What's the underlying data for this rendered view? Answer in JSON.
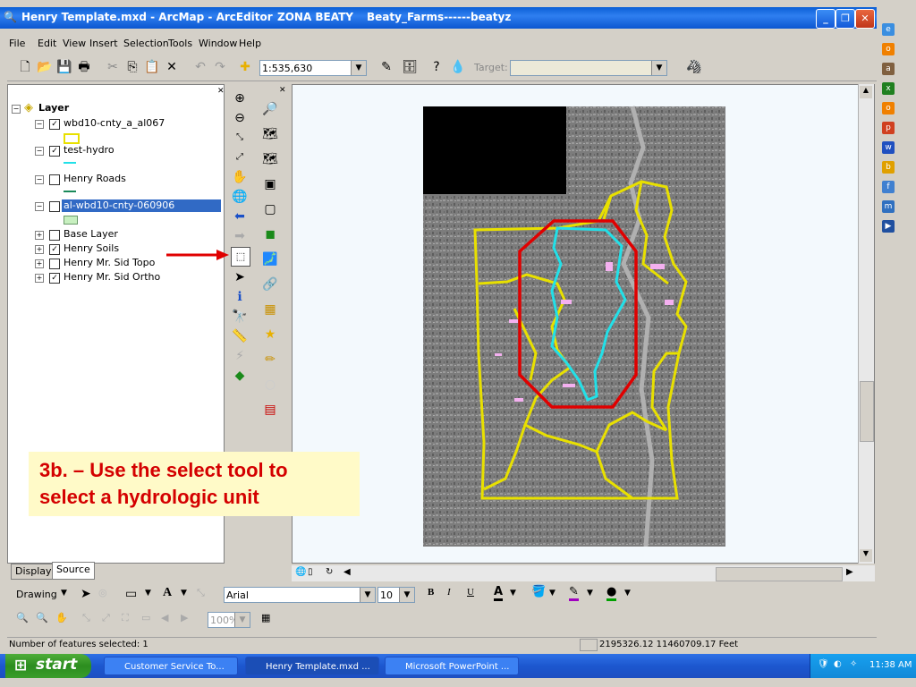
{
  "window": {
    "title": "Henry Template.mxd - ArcMap - ArcEditor",
    "user_label": "ZONA BEATY",
    "path_label": "Beaty_Farms------beatyz"
  },
  "menu": [
    "File",
    "Edit",
    "View",
    "Insert",
    "Selection",
    "Tools",
    "Window",
    "Help"
  ],
  "toolbar": {
    "scale_value": "1:535,630",
    "target_label": "Target:"
  },
  "toc": {
    "root_label": "Layer",
    "layers": [
      {
        "label": "wbd10-cnty_a_al067",
        "checked": true,
        "selected": false
      },
      {
        "label": "test-hydro",
        "checked": true,
        "selected": false
      },
      {
        "label": "Henry Roads",
        "checked": false,
        "selected": false
      },
      {
        "label": "al-wbd10-cnty-060906",
        "checked": false,
        "selected": true
      },
      {
        "label": "Base Layer",
        "checked": false,
        "selected": false
      },
      {
        "label": "Henry Soils",
        "checked": true,
        "selected": false
      },
      {
        "label": "Henry Mr. Sid Topo",
        "checked": false,
        "selected": false
      },
      {
        "label": "Henry Mr. Sid Ortho",
        "checked": true,
        "selected": false
      }
    ],
    "tabs": [
      "Display",
      "Source"
    ]
  },
  "drawing": {
    "drawing_label": "Drawing",
    "font_value": "Arial",
    "size_value": "10",
    "zoom_value": "100%"
  },
  "status": {
    "selected_text": "Number of features selected: 1",
    "coords_text": "2195326.12  11460709.17 Feet"
  },
  "callout": {
    "line1": "3b. – Use the select tool to",
    "line2": "select a hydrologic unit"
  },
  "taskbar": {
    "start_label": "start",
    "items": [
      "Customer Service To...",
      "Henry Template.mxd ...",
      "Microsoft PowerPoint ..."
    ],
    "clock": "11:38 AM"
  },
  "colors": {
    "accent_blue": "#0a5fd6",
    "selection_red": "#e00000",
    "watershed_yellow": "#e8e000",
    "hydro_cyan": "#22e0e8",
    "callout_text": "#d40000"
  }
}
